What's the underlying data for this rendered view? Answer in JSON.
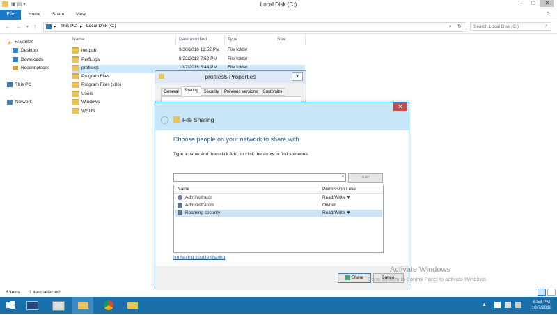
{
  "explorer": {
    "title": "Local Disk (C:)",
    "ribbon_tabs": [
      "File",
      "Home",
      "Share",
      "View"
    ],
    "address": {
      "this_pc": "This PC",
      "local_disk": "Local Disk (C:)"
    },
    "search_placeholder": "Search Local Disk (C:)",
    "nav": {
      "favorites": "Favorites",
      "desktop": "Desktop",
      "downloads": "Downloads",
      "recent_places": "Recent places",
      "this_pc": "This PC",
      "network": "Network"
    },
    "columns": {
      "name": "Name",
      "date_modified": "Date modified",
      "type": "Type",
      "size": "Size"
    },
    "rows": [
      {
        "name": "inetpub",
        "date": "9/30/2016 12:52 PM",
        "type": "File folder"
      },
      {
        "name": "PerfLogs",
        "date": "8/22/2013 7:52 PM",
        "type": "File folder"
      },
      {
        "name": "profiles$",
        "date": "10/7/2016 5:44 PM",
        "type": "File folder"
      },
      {
        "name": "Program Files",
        "date": "",
        "type": ""
      },
      {
        "name": "Program Files (x86)",
        "date": "",
        "type": ""
      },
      {
        "name": "Users",
        "date": "",
        "type": ""
      },
      {
        "name": "Windows",
        "date": "",
        "type": ""
      },
      {
        "name": "WSUS",
        "date": "",
        "type": ""
      }
    ],
    "status": {
      "items": "8 items",
      "selected": "1 item selected"
    }
  },
  "properties": {
    "title": "profiles$ Properties",
    "tabs": [
      "General",
      "Sharing",
      "Security",
      "Previous Versions",
      "Customize"
    ]
  },
  "file_sharing": {
    "title": "File Sharing",
    "heading": "Choose people on your network to share with",
    "instruction": "Type a name and then click Add, or click the arrow to find someone.",
    "add_button": "Add",
    "col_name": "Name",
    "col_permission": "Permission Level",
    "entries": [
      {
        "name": "Administrator",
        "permission": "Read/Write ▼"
      },
      {
        "name": "Administrators",
        "permission": "Owner"
      },
      {
        "name": "Roaming security",
        "permission": "Read/Write ▼"
      }
    ],
    "help_link": "I'm having trouble sharing",
    "share_button": "Share",
    "cancel_button": "Cancel"
  },
  "watermark": {
    "line1": "Activate Windows",
    "line2": "Go to System in Control Panel to activate Windows."
  },
  "taskbar": {
    "time": "5:53 PM",
    "date": "10/7/2016"
  },
  "colors": {
    "accent": "#1979ca",
    "taskbar": "#1b6fa8",
    "dialog_header": "#c8e6f7",
    "heading": "#1f5c99"
  }
}
